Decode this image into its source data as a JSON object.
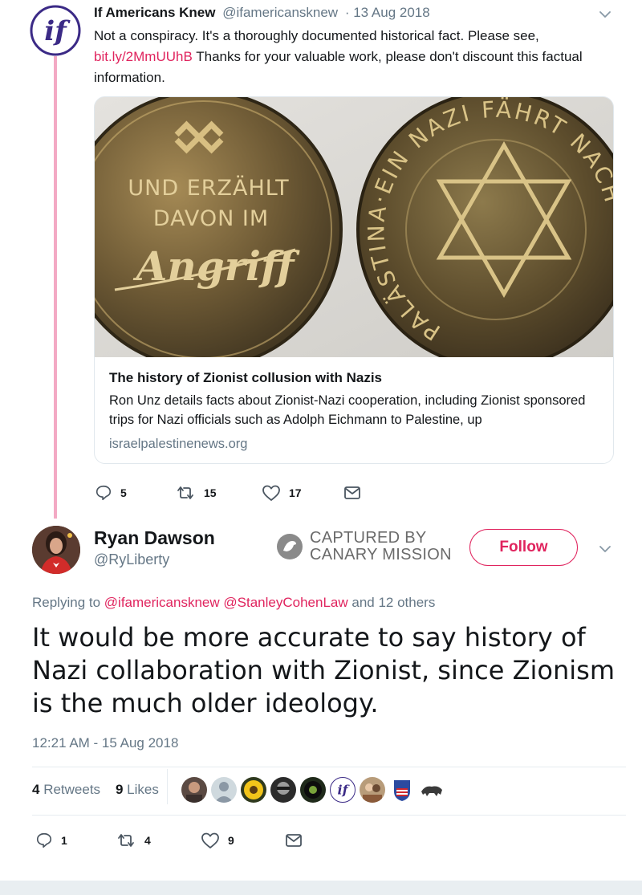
{
  "parent_tweet": {
    "author_name": "If Americans Knew",
    "handle": "@ifamericansknew",
    "date": "· 13 Aug 2018",
    "avatar_text": "if",
    "text_before_link": "Not a conspiracy. It's a thoroughly documented historical fact. Please see, ",
    "link": "bit.ly/2MmUUhB",
    "text_after_link": " Thanks for your valuable work, please don't discount this factual information.",
    "card": {
      "coin_left_line1": "UND ERZÄHLT",
      "coin_left_line2": "DAVON IM",
      "coin_left_script": "Angriff",
      "coin_right_text": "PALÄSTINA·EIN NAZI FÄHRT NACH",
      "title": "The history of Zionist collusion with Nazis",
      "description": "Ron Unz details facts about Zionist-Nazi cooperation, including Zionist sponsored trips for Nazi officials such as Adolph Eichmann to Palestine, up",
      "domain": "israelpalestinenews.org"
    },
    "actions": {
      "replies": "5",
      "retweets": "15",
      "likes": "17"
    }
  },
  "reply_tweet": {
    "author_name": "Ryan Dawson",
    "handle": "@RyLiberty",
    "watermark_line1": "CAPTURED BY",
    "watermark_line2": "CANARY MISSION",
    "follow_label": "Follow",
    "replying_prefix": "Replying to ",
    "replying_user1": "@ifamericansknew",
    "replying_user2": "@StanleyCohenLaw",
    "replying_suffix": " and 12 others",
    "text": "It would be more accurate to say history of Nazi collaboration with Zionist, since Zionism is the much older ideology.",
    "timestamp": "12:21 AM - 15 Aug 2018",
    "retweet_count": "4",
    "retweets_label": " Retweets",
    "like_count": "9",
    "likes_label": " Likes",
    "actions": {
      "replies": "1",
      "retweets": "4",
      "likes": "9"
    }
  },
  "colors": {
    "accent": "#e0245e",
    "thread_line": "#f3a9c4",
    "muted": "#657786",
    "if_logo": "#3b2a86"
  }
}
